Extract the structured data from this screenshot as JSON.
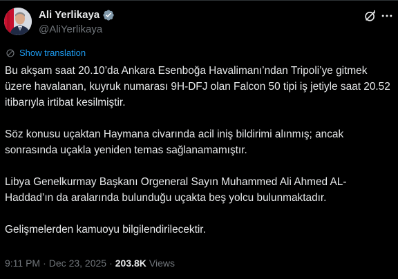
{
  "author": {
    "display_name": "Ali Yerlikaya",
    "handle": "@AliYerlikaya",
    "verified": true
  },
  "icons": {
    "avatar": "avatar",
    "verified": "verified-badge-icon",
    "grok": "grok-icon",
    "more": "more-icon",
    "translate": "translate-icon"
  },
  "translate": {
    "label": "Show translation"
  },
  "body": {
    "paragraphs": [
      "Bu akşam saat 20.10’da Ankara Esenboğa Havalimanı’ndan Tripoli’ye gitmek üzere havalanan, kuyruk numarası 9H-DFJ olan Falcon 50 tipi iş jetiyle saat 20.52 itibarıyla irtibat kesilmiştir.",
      "Söz konusu uçaktan Haymana civarında acil iniş bildirimi alınmış; ancak sonrasında uçakla yeniden temas sağlanamamıştır.",
      "Libya Genelkurmay Başkanı Orgeneral Sayın Muhammed Ali Ahmed AL-Haddad’ın da aralarında bulunduğu uçakta beş yolcu bulunmaktadır.",
      "Gelişmelerden kamuoyu bilgilendirilecektir."
    ]
  },
  "meta": {
    "time": "9:11 PM",
    "separator": "·",
    "date": "Dec 23, 2025",
    "views_count": "203.8K",
    "views_label": "Views"
  },
  "colors": {
    "background": "#000000",
    "text": "#e7e9ea",
    "muted": "#71767b",
    "link": "#1d9bf0",
    "verified": "#829aab"
  }
}
